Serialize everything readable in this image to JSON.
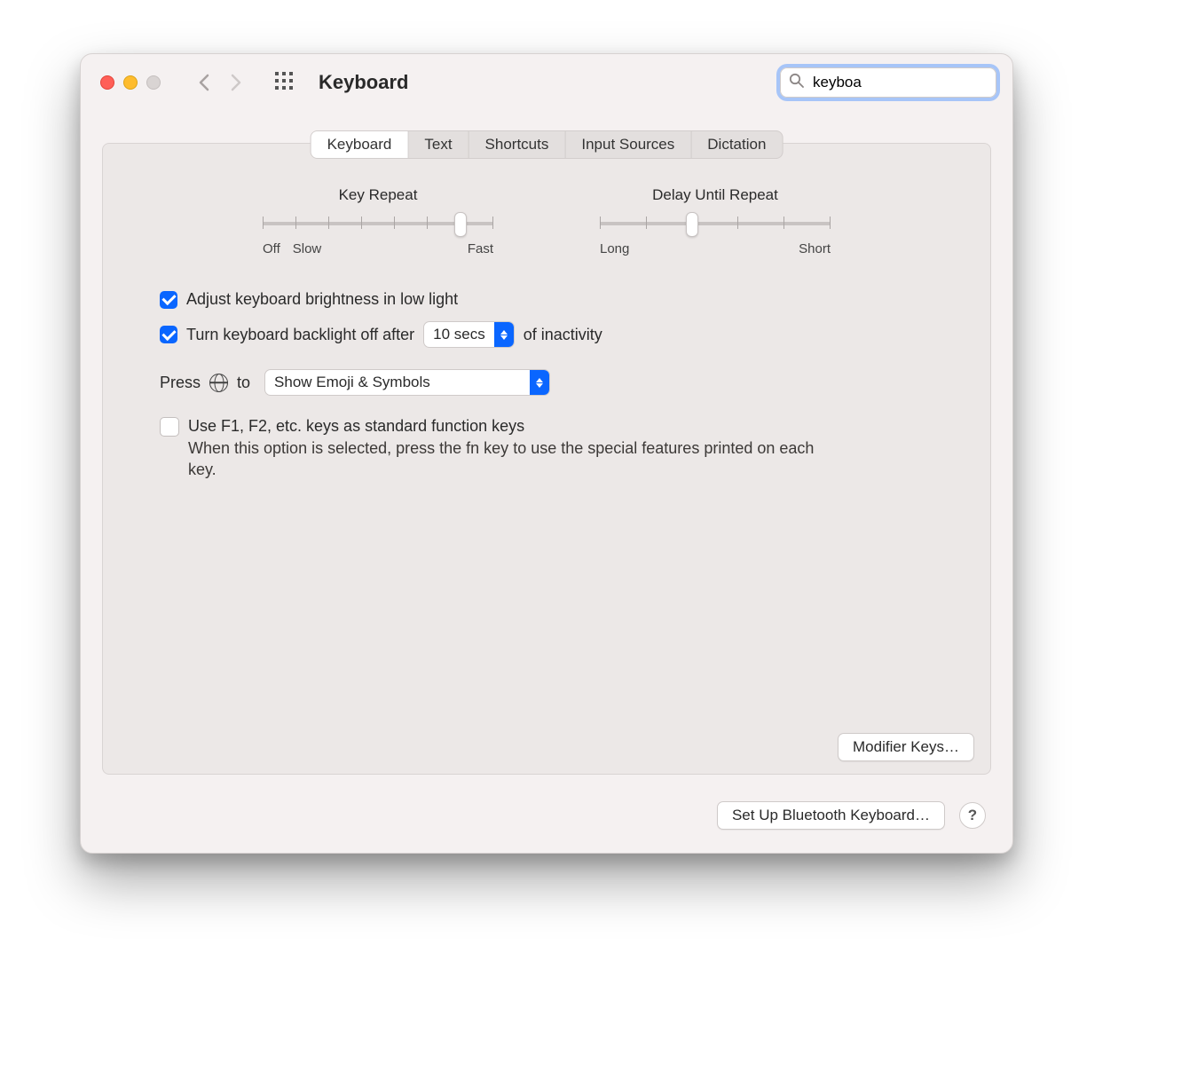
{
  "window": {
    "title": "Keyboard"
  },
  "search": {
    "value": "keyboa"
  },
  "tabs": {
    "items": [
      "Keyboard",
      "Text",
      "Shortcuts",
      "Input Sources",
      "Dictation"
    ],
    "active_index": 0
  },
  "sliders": {
    "key_repeat": {
      "title": "Key Repeat",
      "left_label_1": "Off",
      "left_label_2": "Slow",
      "right_label": "Fast",
      "ticks": 8,
      "value_index": 6
    },
    "delay": {
      "title": "Delay Until Repeat",
      "left_label": "Long",
      "right_label": "Short",
      "ticks": 6,
      "value_index": 2
    }
  },
  "options": {
    "brightness": {
      "checked": true,
      "label": "Adjust keyboard brightness in low light"
    },
    "backlight": {
      "checked": true,
      "label_before": "Turn keyboard backlight off after",
      "select_value": "10 secs",
      "label_after": "of inactivity"
    },
    "globe": {
      "label_before": "Press",
      "label_after": "to",
      "select_value": "Show Emoji & Symbols"
    },
    "fn_keys": {
      "checked": false,
      "label": "Use F1, F2, etc. keys as standard function keys",
      "hint": "When this option is selected, press the fn key to use the special features printed on each key."
    }
  },
  "buttons": {
    "modifier": "Modifier Keys…",
    "bluetooth": "Set Up Bluetooth Keyboard…",
    "help": "?"
  }
}
